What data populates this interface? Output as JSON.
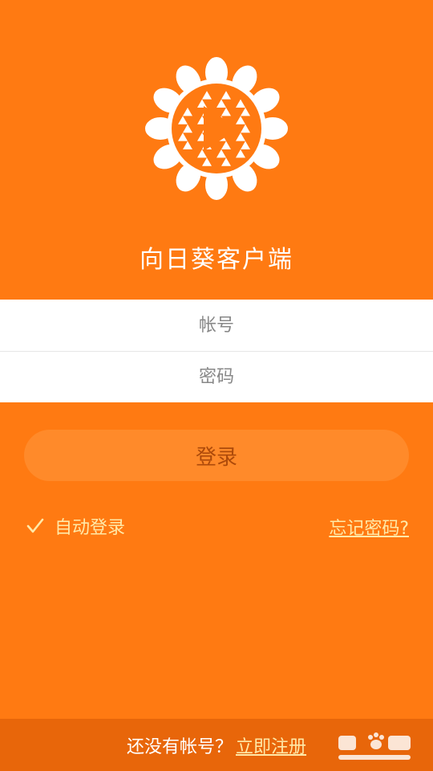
{
  "app": {
    "title": "向日葵客户端"
  },
  "form": {
    "account_placeholder": "帐号",
    "password_placeholder": "密码"
  },
  "login_button": "登录",
  "auto_login": {
    "label": "自动登录",
    "checked": true
  },
  "forgot_password": "忘记密码?",
  "footer": {
    "prompt": "还没有帐号？",
    "register": "立即注册"
  },
  "colors": {
    "background": "#ff7a12",
    "footer": "#e8660a",
    "link": "#ffe9a8",
    "button": "#ff8a2a"
  },
  "icons": [
    "sunflower-logo-icon",
    "checkmark-icon",
    "baidu-jingyan-watermark"
  ]
}
